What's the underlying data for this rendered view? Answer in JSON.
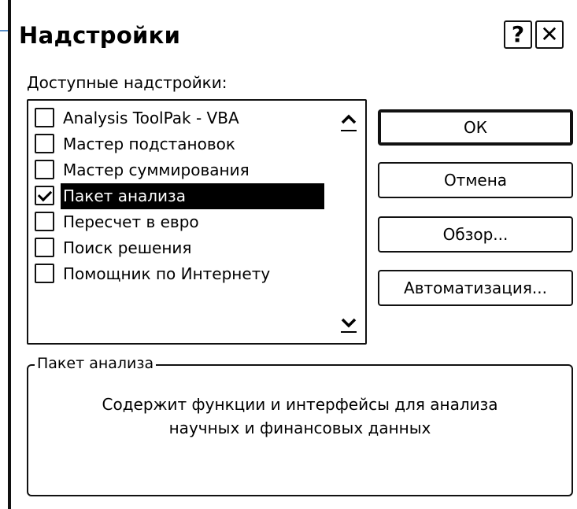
{
  "window": {
    "title": "Надстройки",
    "help_glyph": "?",
    "close_glyph": "✕"
  },
  "addins": {
    "label": "Доступные надстройки:",
    "items": [
      {
        "label": "Analysis ToolPak - VBA",
        "checked": false,
        "selected": false
      },
      {
        "label": "Мастер подстановок",
        "checked": false,
        "selected": false
      },
      {
        "label": "Мастер суммирования",
        "checked": false,
        "selected": false
      },
      {
        "label": "Пакет анализа",
        "checked": true,
        "selected": true
      },
      {
        "label": "Пересчет в евро",
        "checked": false,
        "selected": false
      },
      {
        "label": "Поиск решения",
        "checked": false,
        "selected": false
      },
      {
        "label": "Помощник по Интернету",
        "checked": false,
        "selected": false
      }
    ],
    "scroll_up_icon": "chevron-up-icon",
    "scroll_down_icon": "chevron-down-icon"
  },
  "buttons": {
    "ok": "ОК",
    "cancel": "Отмена",
    "browse": "Обзор...",
    "automation": "Автоматизация..."
  },
  "description": {
    "group_title": "Пакет анализа",
    "line1": "Содержит функции и интерфейсы для анализа",
    "line2": "научных и финансовых данных"
  },
  "colors": {
    "selection_bg": "#000000",
    "selection_fg": "#ffffff",
    "accent_line": "#5a8fc8"
  }
}
